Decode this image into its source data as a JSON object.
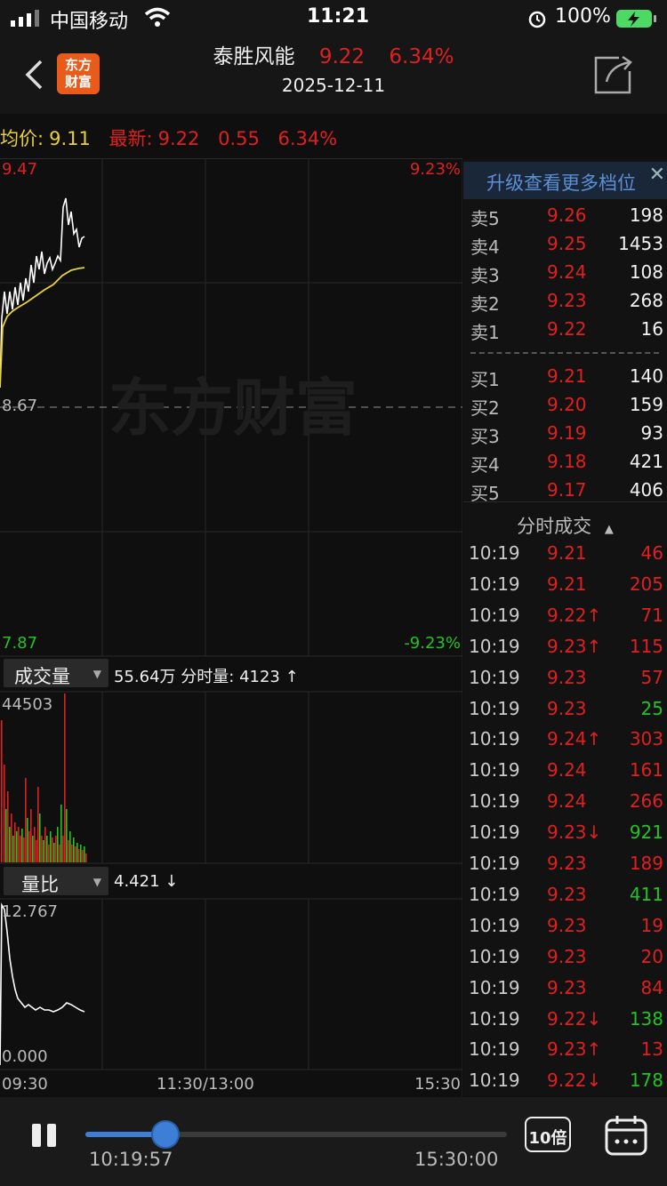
{
  "status": {
    "carrier": "中国移动",
    "time": "11:21",
    "battery": "100%"
  },
  "header": {
    "name": "泰胜风能",
    "price": "9.22",
    "change_pct": "6.34%",
    "date": "2025-12-11",
    "logo_line1": "东方",
    "logo_line2": "财富"
  },
  "info": {
    "avg_label": "均价:",
    "avg_value": "9.11",
    "latest_label": "最新:",
    "latest_value": "9.22",
    "change": "0.55",
    "change_pct": "6.34%"
  },
  "price_chart": {
    "high": "9.47",
    "high_pct": "9.23%",
    "mid": "8.67",
    "low": "7.87",
    "low_pct": "-9.23%",
    "watermark": "东方财富"
  },
  "volume_panel": {
    "dropdown": "成交量",
    "total": "55.64万",
    "tick_label": "分时量:",
    "tick_value": "4123",
    "tick_arrow": "↑",
    "max": "44503"
  },
  "ratio_panel": {
    "dropdown": "量比",
    "value": "4.421",
    "arrow": "↓",
    "max": "12.767",
    "min": "0.000"
  },
  "time_axis": {
    "start": "09:30",
    "mid": "11:30/13:00",
    "end": "15:30"
  },
  "order_book": {
    "upgrade": "升级查看更多档位",
    "asks": [
      {
        "label": "卖5",
        "price": "9.26",
        "vol": "198"
      },
      {
        "label": "卖4",
        "price": "9.25",
        "vol": "1453"
      },
      {
        "label": "卖3",
        "price": "9.24",
        "vol": "108"
      },
      {
        "label": "卖2",
        "price": "9.23",
        "vol": "268"
      },
      {
        "label": "卖1",
        "price": "9.22",
        "vol": "16"
      }
    ],
    "bids": [
      {
        "label": "买1",
        "price": "9.21",
        "vol": "140"
      },
      {
        "label": "买2",
        "price": "9.20",
        "vol": "159"
      },
      {
        "label": "买3",
        "price": "9.19",
        "vol": "93"
      },
      {
        "label": "买4",
        "price": "9.18",
        "vol": "421"
      },
      {
        "label": "买5",
        "price": "9.17",
        "vol": "406"
      }
    ]
  },
  "trades": {
    "header": "分时成交",
    "rows": [
      {
        "time": "10:19",
        "price": "9.21",
        "vol": "46",
        "color": "#e02020"
      },
      {
        "time": "10:19",
        "price": "9.21",
        "vol": "205",
        "color": "#e02020"
      },
      {
        "time": "10:19",
        "price": "9.22↑",
        "vol": "71",
        "color": "#e02020"
      },
      {
        "time": "10:19",
        "price": "9.23↑",
        "vol": "115",
        "color": "#e02020"
      },
      {
        "time": "10:19",
        "price": "9.23",
        "vol": "57",
        "color": "#e02020"
      },
      {
        "time": "10:19",
        "price": "9.23",
        "vol": "25",
        "color": "#22c322"
      },
      {
        "time": "10:19",
        "price": "9.24↑",
        "vol": "303",
        "color": "#e02020"
      },
      {
        "time": "10:19",
        "price": "9.24",
        "vol": "161",
        "color": "#e02020"
      },
      {
        "time": "10:19",
        "price": "9.24",
        "vol": "266",
        "color": "#e02020"
      },
      {
        "time": "10:19",
        "price": "9.23↓",
        "vol": "921",
        "color": "#22c322"
      },
      {
        "time": "10:19",
        "price": "9.23",
        "vol": "189",
        "color": "#e02020"
      },
      {
        "time": "10:19",
        "price": "9.23",
        "vol": "411",
        "color": "#22c322"
      },
      {
        "time": "10:19",
        "price": "9.23",
        "vol": "19",
        "color": "#e02020"
      },
      {
        "time": "10:19",
        "price": "9.23",
        "vol": "20",
        "color": "#e02020"
      },
      {
        "time": "10:19",
        "price": "9.23",
        "vol": "84",
        "color": "#e02020"
      },
      {
        "time": "10:19",
        "price": "9.22↓",
        "vol": "138",
        "color": "#22c322"
      },
      {
        "time": "10:19",
        "price": "9.23↑",
        "vol": "13",
        "color": "#e02020"
      },
      {
        "time": "10:19",
        "price": "9.22↓",
        "vol": "178",
        "color": "#22c322"
      }
    ]
  },
  "playback": {
    "current": "10:19:57",
    "end": "15:30:00",
    "speed": "10倍",
    "progress": 0.19
  },
  "colors": {
    "up": "#e02020",
    "down": "#22c322",
    "avg": "#e8d23a",
    "accent": "#3d7fd6"
  }
}
